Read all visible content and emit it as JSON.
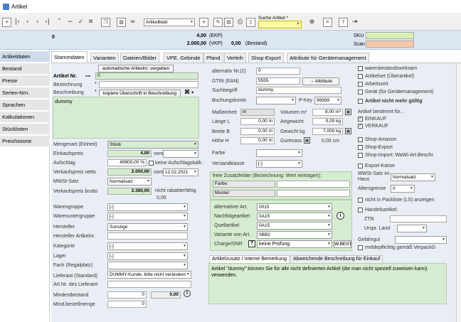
{
  "window": {
    "title": "Artikel"
  },
  "toolbar": {
    "view_select": "Artikelblatt",
    "search_label": "Suche Artikel *"
  },
  "info": {
    "left_value": "0",
    "ekp_value": "4,00",
    "ekp_label": "(EKP)",
    "vkp_value": "2.000,00",
    "vkp_label": "(VKP)",
    "bestand_value": "0,00",
    "bestand_label": "(Bestand)",
    "sku_label": "SKU",
    "scan_label": "Scan"
  },
  "sidebar": {
    "items": [
      {
        "label": "Artikeldaten"
      },
      {
        "label": "Bestand"
      },
      {
        "label": "Preise"
      },
      {
        "label": "Serien-Nrn."
      },
      {
        "label": "Sprachen"
      },
      {
        "label": "Kalkulationen"
      },
      {
        "label": "Stücklisten"
      },
      {
        "label": "Preishistorie"
      }
    ]
  },
  "tabs": [
    {
      "label": "Stammdaten"
    },
    {
      "label": "Varianten"
    },
    {
      "label": "Dateien/Bilder"
    },
    {
      "label": "VPE, Gebinde"
    },
    {
      "label": "Pfand"
    },
    {
      "label": "Verleih"
    },
    {
      "label": "Shop-Export"
    },
    {
      "label": "Attribute für Gerätemanagement"
    }
  ],
  "left": {
    "auto_artnr_btn": "automatische Artikelnr. vergeben",
    "artnr_label": "Artikel Nr.",
    "artnr_value": "0",
    "bez_label": "Bezeichnung",
    "beschr_label": "Beschreibung",
    "copy_btn": "kopiere Überschrift in Beschreibung",
    "desc_text": "dummy",
    "me_label": "Mengenart (Einheit)",
    "me_value": "Stück",
    "ek_label": "Einkaufspreis",
    "ek_value": "4,00",
    "vom_label": "vom",
    "aufschlag_label": "Aufschlag",
    "aufschlag_value": "49900,00 %",
    "keine_aufschlag": "keine Aufschlagskalk.",
    "vkn_label": "Verkaufspreis netto",
    "vkn_value": "2.000,00",
    "vkn_vom": "vom",
    "vkn_date": "12.02.2021",
    "mwst_label": "MWSt-Satz",
    "mwst_value": "Normalsatz",
    "vkb_label": "Verkaufspreis brutto",
    "vkb_value": "2.380,00",
    "nicht_rabatt": "nicht rabattierfähig",
    "small_zero": "0,00",
    "wg_label": "Warengruppe",
    "wg_value": "[-]",
    "wug_label": "Warenuntergruppe",
    "wug_value": "[-]",
    "hersteller_label": "Hersteller",
    "hersteller_value": "Sonstige",
    "hersteller_artnr_label": "Hersteller Artikelnr.",
    "kategorie_label": "Kategorie",
    "kategorie_value": "[-]",
    "lager_label": "Lager",
    "lager_value": "[-]",
    "fach_label": "Fach (Regalplatz)",
    "lieferant_label": "Lieferant (Standard)",
    "lieferant_value": "DUMMY-Kunde, bitte nicht verändern",
    "artnr_lief_label": "Art.Nr. des Lieferant",
    "mindest_label": "Mindestbestand",
    "mindest_value": "0",
    "mindest_value2": "0,00",
    "mindbest_label": "Mind.bestellmenge",
    "mindbest_value": "0"
  },
  "middle": {
    "altnr_label": "alternativ Nr.(2)",
    "altnr_value": "0",
    "gtin_label": "GTIN (EAN)",
    "gtin_value": "5555",
    "attribute_btn": "Attribute",
    "suchbegriff_label": "Suchbegriff",
    "suchbegriff_value": "dummy",
    "buchungskonto_label": "Buchungskonto",
    "pkey_label": "P-Key",
    "pkey_value": "99999",
    "masseinheit_label": "Maßeinheit",
    "masseinheit_value": "m",
    "laenge_label": "Länge L",
    "laenge_value": "0,00 m",
    "breite_label": "Breite B",
    "breite_value": "0,00 m",
    "hoehe_label": "Höhe H",
    "hoehe_value": "0,00 m",
    "volumen_label": "Volumen m³",
    "volumen_value": "8,00 m³",
    "artgewicht_label": "Artgewicht",
    "artgewicht_value": "0,00 kg",
    "gewicht_label": "Gewicht kg",
    "gewicht_value": "7,000 kg",
    "gurtmass_label": "Gurtmass",
    "gurtmass_value": "0,00 cm",
    "farbe_label": "Farbe",
    "versand_label": "Versandklasse",
    "versand_value": "[-]",
    "zusatz_title": "freie Zusatzfelder (Bezeichnung: Wert eintragen):",
    "zusatz_farbe": "Farbe:",
    "zusatz_muster": "Muster:",
    "altart_label": "alternativer Art.",
    "altart_value": "0015",
    "nachfolge_label": "Nachfolgeartikel",
    "nachfolge_value": "0A15",
    "quell_label": "Quellartikel",
    "quell_value": "0A15",
    "variante_label": "Variante von Art.",
    "variante_value": "0BB2",
    "charge_label": "Charge/SNR",
    "charge_value": "keine Prüfung",
    "wbest_btn": "W.BEST"
  },
  "bottom_tabs": [
    {
      "label": "Artikelzusatz / Interne Bemerkung"
    },
    {
      "label": "Abweichende Beschreibung für Einkauf"
    }
  ],
  "note_text": "Artikel \"dummy\" können Sie für alle nicht definierten Artikel (die man nicht speziell zuweisen kann) verwenden.",
  "right": {
    "checks": [
      {
        "label": "warenbestandswirksam",
        "checked": false
      },
      {
        "label": "Artikelset (Überartikel)",
        "checked": false
      },
      {
        "label": "Arbeitszeit",
        "checked": false
      },
      {
        "label": "Gerät (für Gerätemanagement)",
        "checked": false
      },
      {
        "label": "Artikel nicht mehr gültig",
        "checked": false
      }
    ],
    "bestimmt_label": "Artikel bestimmt für...",
    "einkauf": {
      "label": "EINKAUF",
      "checked": true
    },
    "verkauf": {
      "label": "VERKAUF",
      "checked": true
    },
    "shop_amazon": "Shop-Amazon",
    "shop_export": "Shop-Export",
    "shop_import": "Shop-Import: WaWi-Art.Beschr.",
    "export_kasse": "Export-Kasse",
    "mwst_haus_label": "MWSt-Satz im Haus",
    "mwst_haus_value": "Normalsatz",
    "altersgrenze_label": "Altersgrenze",
    "altersgrenze_value": "0",
    "packliste": "nicht in Packliste (LS) anzeigen",
    "handelsartikel": "Handelsartikel:",
    "ztn_label": "ZTN",
    "ursprung_label": "Urspr. Land",
    "gefahrgut_label": "Gefahrgut",
    "verpackg": "meldepflichtig gemäß VerpackG"
  },
  "colors": {
    "accent_green": "#d6ecd0",
    "search_yellow": "#fff9a6",
    "sku_green": "#d8f0b8",
    "scan_salmon": "#f8c8a8",
    "infobar": "#dce6f2"
  }
}
